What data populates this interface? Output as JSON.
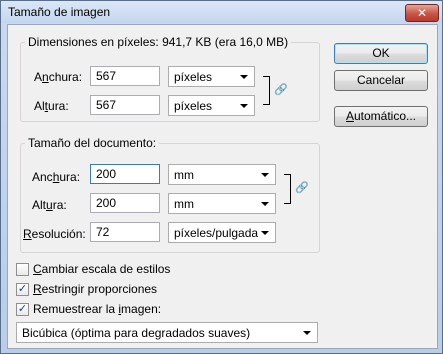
{
  "window": {
    "title": "Tamaño de imagen",
    "close_glyph": "✕"
  },
  "pixel_dims": {
    "title": "Dimensiones en píxeles: 941,7 KB (era 16,0 MB)",
    "width_label_pre": "A",
    "width_label_u": "n",
    "width_label_post": "chura:",
    "width_value": "567",
    "width_unit": "píxeles",
    "height_label_pre": "Al",
    "height_label_u": "t",
    "height_label_post": "ura:",
    "height_value": "567",
    "height_unit": "píxeles"
  },
  "doc_size": {
    "title": "Tamaño del documento:",
    "width_label_pre": "Anc",
    "width_label_u": "h",
    "width_label_post": "ura:",
    "width_value": "200",
    "width_unit": "mm",
    "height_label_pre": "Alt",
    "height_label_u": "u",
    "height_label_post": "ra:",
    "height_value": "200",
    "height_unit": "mm",
    "res_label_pre": "",
    "res_label_u": "R",
    "res_label_post": "esolución:",
    "res_value": "72",
    "res_unit": "píxeles/pulgada"
  },
  "buttons": {
    "ok": "OK",
    "cancel": "Cancelar",
    "auto_u": "A",
    "auto_post": "utomático..."
  },
  "options": {
    "scale_styles_u": "C",
    "scale_styles_post": "ambiar escala de estilos",
    "scale_styles_checked": false,
    "constrain_u": "R",
    "constrain_post": "estringir proporciones",
    "constrain_checked": true,
    "resample_pre": "Remuestrear la ",
    "resample_u": "i",
    "resample_post": "magen:",
    "resample_checked": true,
    "resample_method": "Bicúbica (óptima para degradados suaves)"
  },
  "icons": {
    "chain": "chain-link-icon",
    "check": "checkmark-icon",
    "arrow": "chevron-down-icon"
  }
}
